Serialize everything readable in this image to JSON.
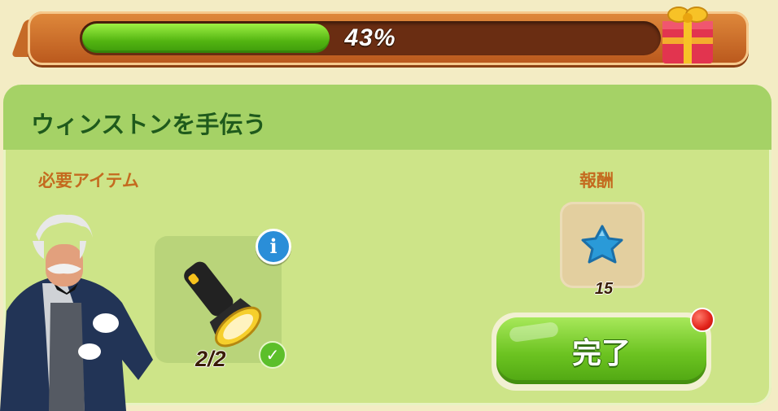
{
  "progress": {
    "percent": 0.43,
    "label": "43%"
  },
  "task": {
    "title": "ウィンストンを手伝う",
    "required_label": "必要アイテム",
    "reward_label": "報酬",
    "required_item": {
      "icon": "flashlight-icon",
      "count": "2/2",
      "complete": true
    },
    "reward": {
      "icon": "blue-star-icon",
      "amount": "15"
    },
    "complete_button": "完了"
  },
  "colors": {
    "progress_fill": "#52b411",
    "panel_bg": "#cde488",
    "header_bg": "#a5d266",
    "title_color": "#1f5a1c",
    "label_color": "#c46a1f",
    "button_green": "#6cc321",
    "notification_red": "#e2231a"
  }
}
